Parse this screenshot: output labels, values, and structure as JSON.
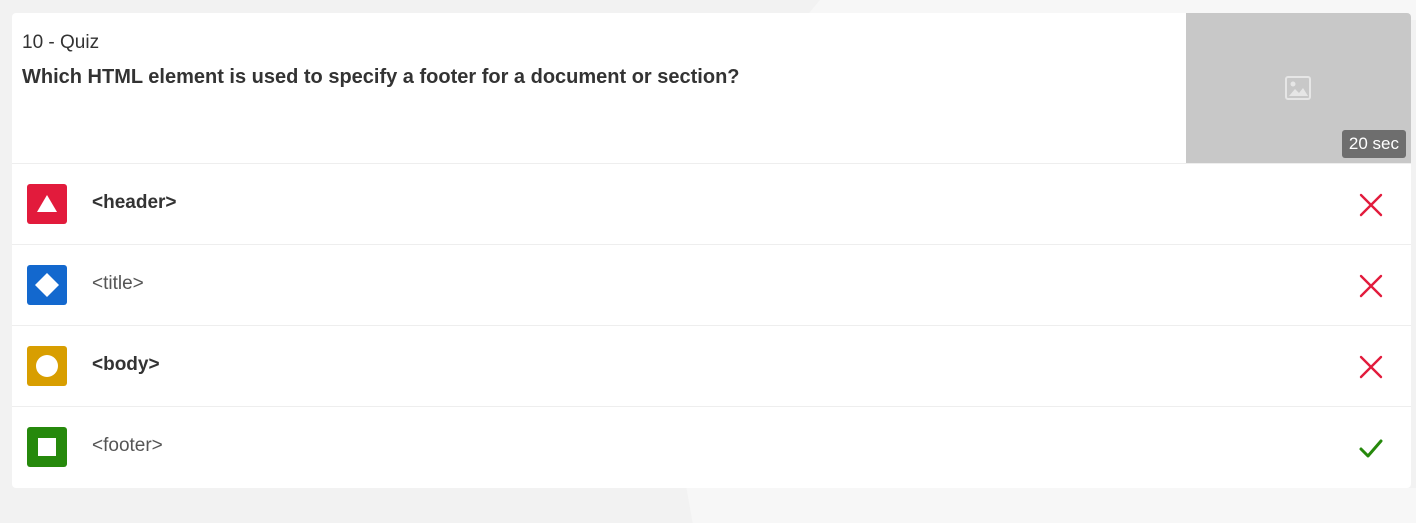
{
  "question": {
    "meta": "10 - Quiz",
    "text": "Which HTML element is used to specify a footer for a document or section?",
    "time_limit": "20 sec",
    "media_icon": "image-placeholder-icon"
  },
  "answers": [
    {
      "label": "<header>",
      "shape": "triangle-icon",
      "color": "#e21b3c",
      "correct": false,
      "bold": true
    },
    {
      "label": "<title>",
      "shape": "diamond-icon",
      "color": "#1368ce",
      "correct": false,
      "bold": false
    },
    {
      "label": "<body>",
      "shape": "circle-icon",
      "color": "#d89e00",
      "correct": false,
      "bold": true
    },
    {
      "label": "<footer>",
      "shape": "square-icon",
      "color": "#26890c",
      "correct": true,
      "bold": false
    }
  ],
  "colors": {
    "incorrect_mark": "#e21b3c",
    "correct_mark": "#26890c"
  }
}
